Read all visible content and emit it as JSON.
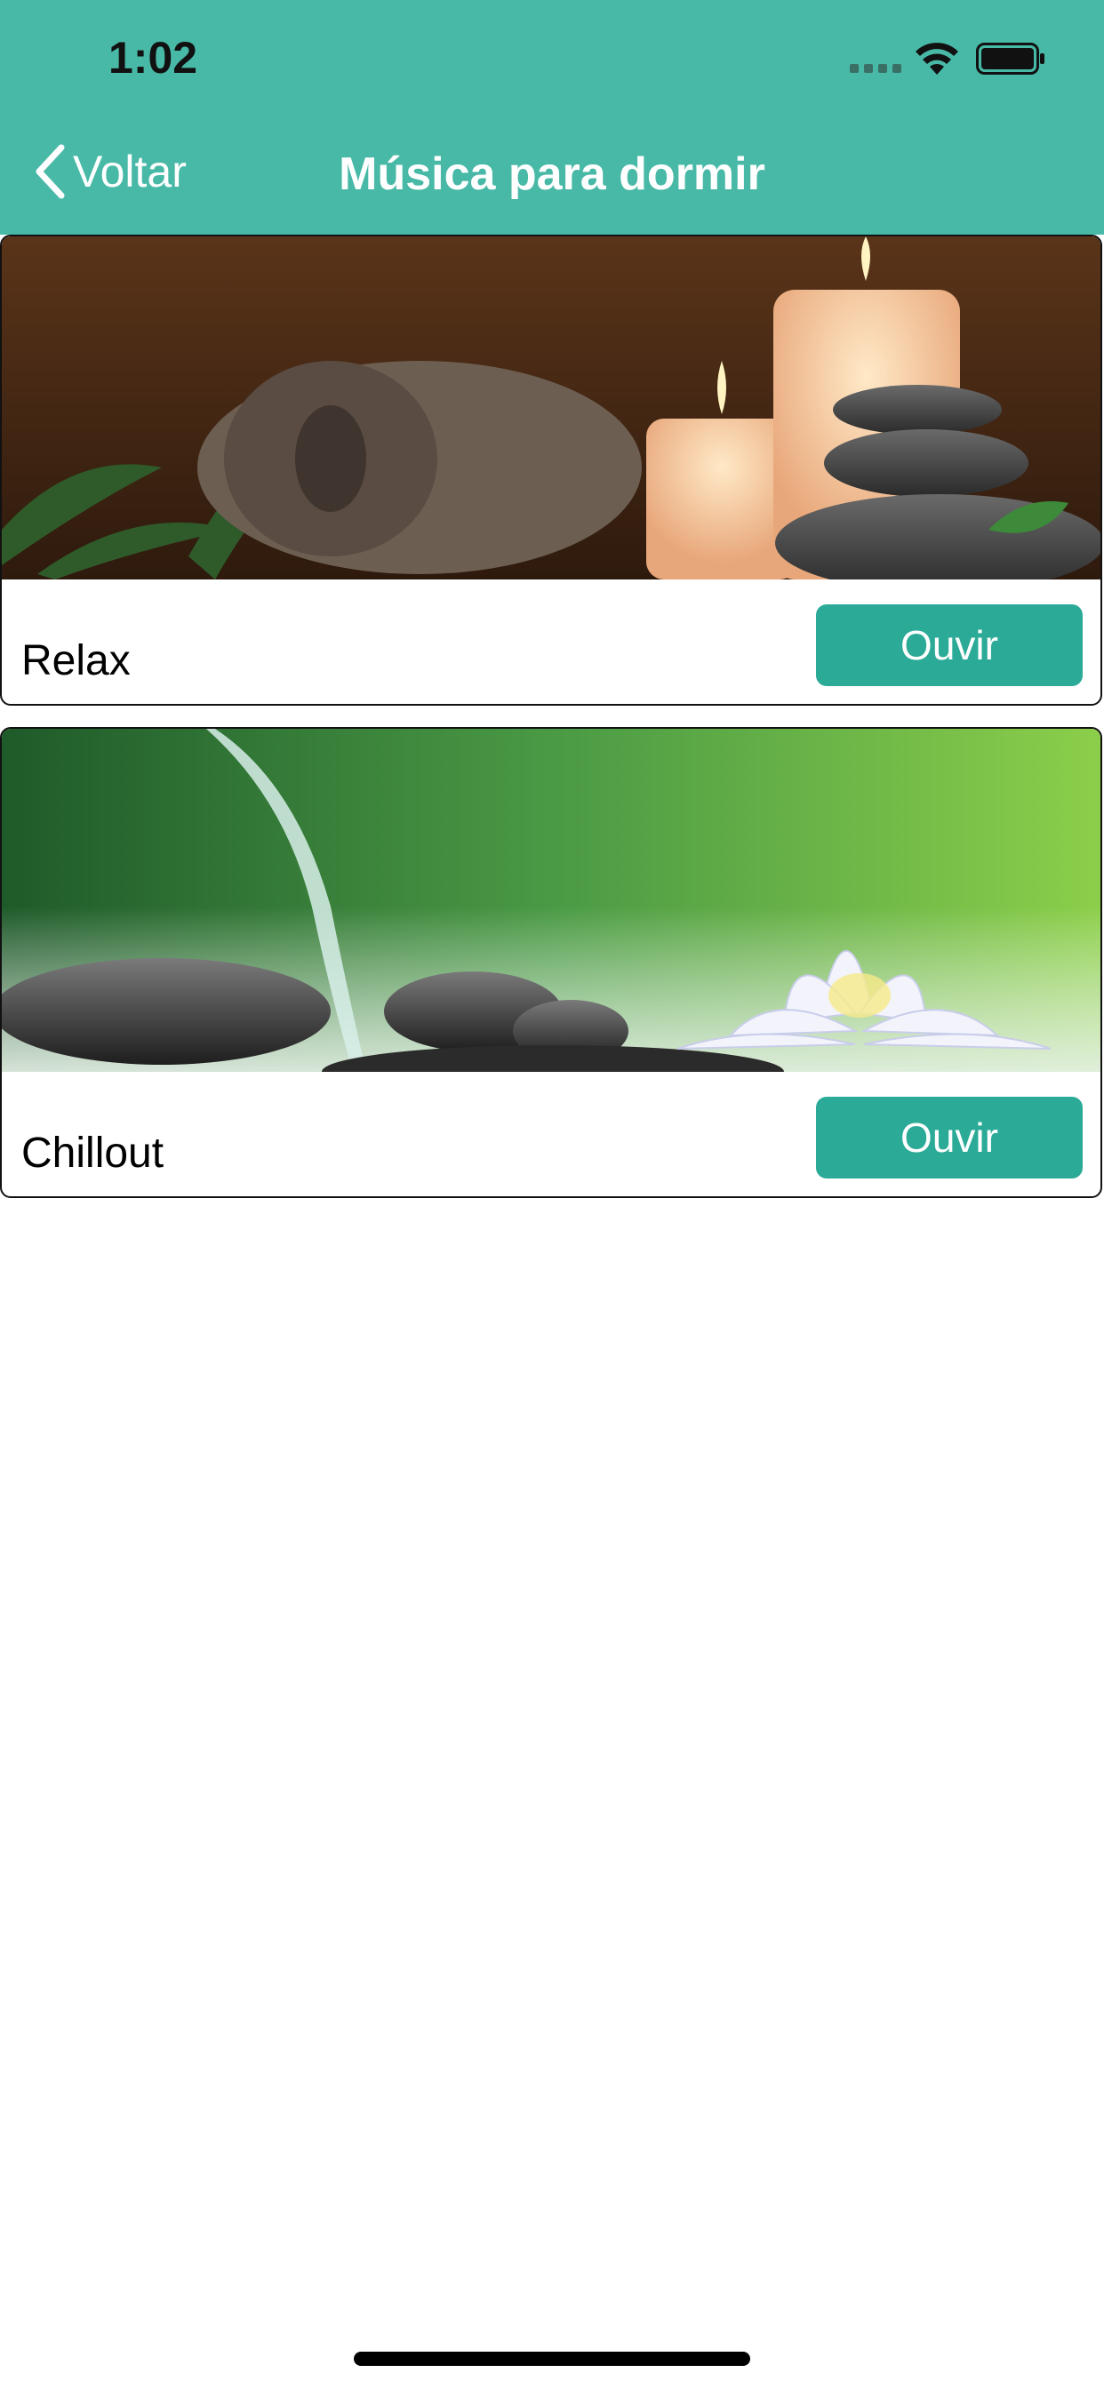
{
  "status_bar": {
    "time": "1:02"
  },
  "nav": {
    "back_label": "Voltar",
    "title": "Música para dormir"
  },
  "cards": [
    {
      "label": "Relax",
      "button_label": "Ouvir",
      "image": "spa-towel-candles-stones"
    },
    {
      "label": "Chillout",
      "button_label": "Ouvir",
      "image": "lotus-water-stones"
    }
  ],
  "colors": {
    "header": "#48b9a7",
    "button": "#2bab97"
  }
}
